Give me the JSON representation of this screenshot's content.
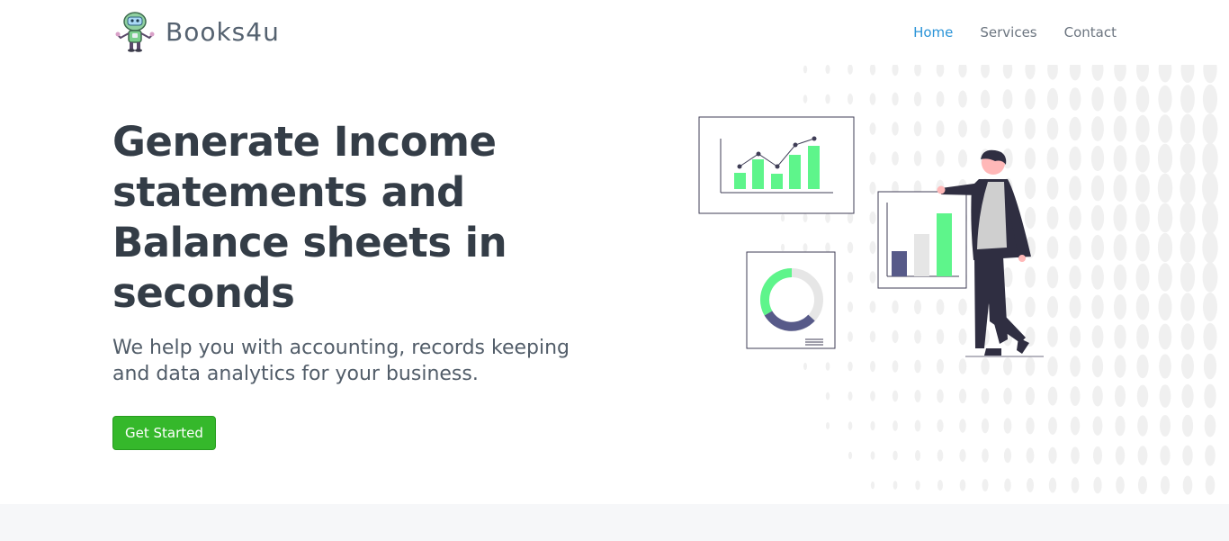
{
  "header": {
    "brand": "Books4u",
    "logo_icon": "robot-mascot-icon",
    "nav": [
      {
        "label": "Home",
        "active": true
      },
      {
        "label": "Services",
        "active": false
      },
      {
        "label": "Contact",
        "active": false
      }
    ]
  },
  "hero": {
    "headline_lines": [
      "Generate Income",
      "statements and",
      "Balance sheets in",
      "seconds"
    ],
    "subtext_lines": [
      "We help you with accounting, records keeping",
      "and data analytics for your business."
    ],
    "cta_label": "Get Started"
  },
  "colors": {
    "accent_blue": "#2b94d8",
    "cta_green": "#35b82b",
    "chart_green": "#5ef58b",
    "chart_navy": "#575a89",
    "heading": "#343d47",
    "band": "#f6f7f9"
  }
}
